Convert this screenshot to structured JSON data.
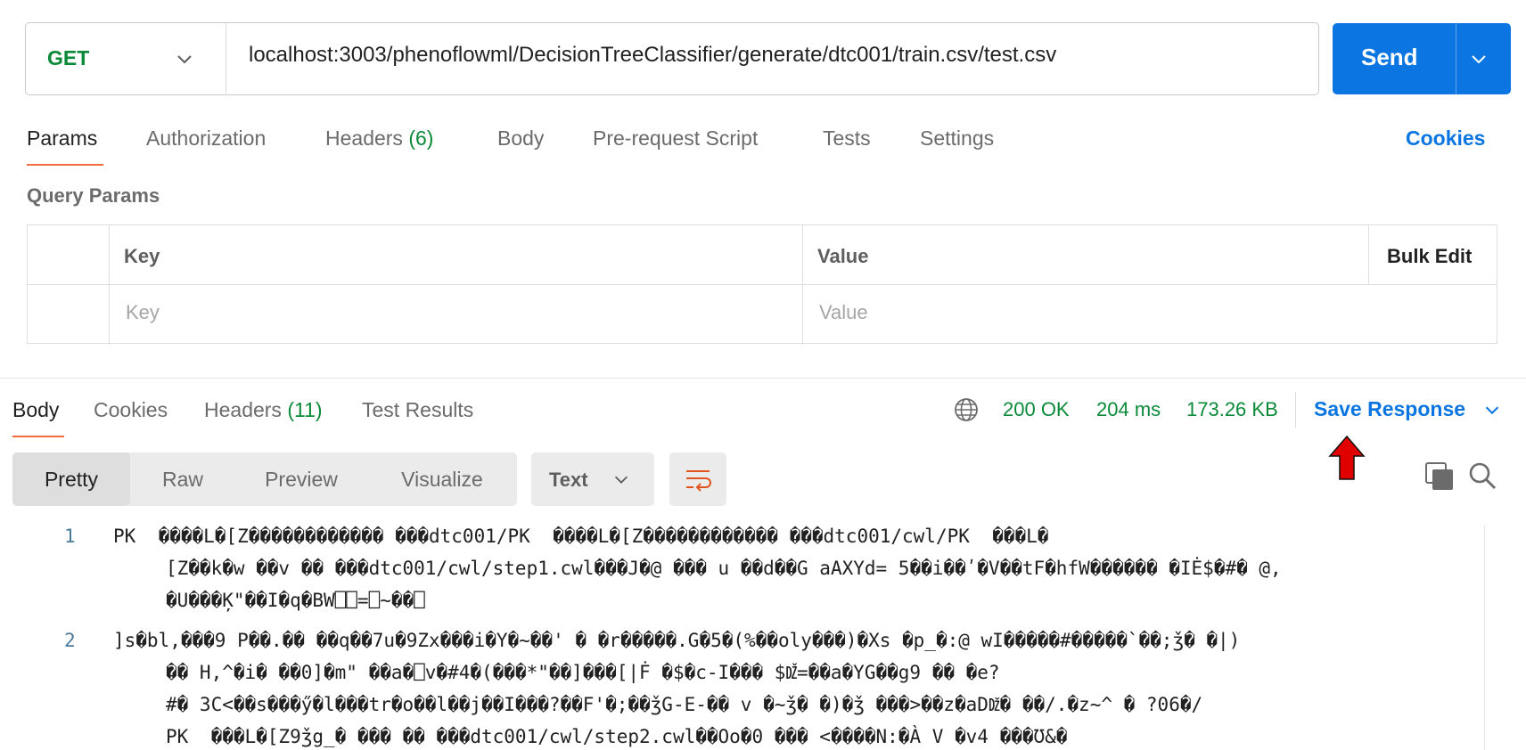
{
  "request": {
    "method": "GET",
    "url": "localhost:3003/phenoflowml/DecisionTreeClassifier/generate/dtc001/train.csv/test.csv",
    "send_label": "Send"
  },
  "request_tabs": [
    {
      "label": "Params",
      "count": ""
    },
    {
      "label": "Authorization",
      "count": ""
    },
    {
      "label": "Headers",
      "count": "(6)"
    },
    {
      "label": "Body",
      "count": ""
    },
    {
      "label": "Pre-request Script",
      "count": ""
    },
    {
      "label": "Tests",
      "count": ""
    },
    {
      "label": "Settings",
      "count": ""
    }
  ],
  "cookies_label": "Cookies",
  "query_params": {
    "title": "Query Params",
    "headers": {
      "key": "Key",
      "value": "Value",
      "bulk_edit": "Bulk Edit"
    },
    "placeholders": {
      "key": "Key",
      "value": "Value"
    }
  },
  "response_tabs": [
    {
      "label": "Body",
      "count": ""
    },
    {
      "label": "Cookies",
      "count": ""
    },
    {
      "label": "Headers",
      "count": "(11)"
    },
    {
      "label": "Test Results",
      "count": ""
    }
  ],
  "response_status": {
    "status": "200 OK",
    "time": "204 ms",
    "size": "173.26 KB",
    "save_label": "Save Response"
  },
  "view_modes": [
    "Pretty",
    "Raw",
    "Preview",
    "Visualize"
  ],
  "format": "Text",
  "colors": {
    "accent": "#0b76e2",
    "success": "#0a8a38",
    "active_tab": "#f26b3a",
    "annotation_arrow": "#e00000"
  },
  "icons": [
    "chevron-down-icon",
    "globe-icon",
    "word-wrap-icon",
    "copy-icon",
    "search-icon",
    "red-arrow-icon"
  ],
  "code_lines": [
    {
      "num": "1",
      "text": "PK  ����L�[Z������������ ���dtc001/PK  ����L�[Z������������ ���dtc001/cwl/PK  ���L�"
    },
    {
      "num": "",
      "text": "[Z��k�w ��v �� ���dtc001/cwl/step1.cwl���J�@ ��� u ��d��G aAXYd= 5��i��ʹ�V��tF�hfW������ �IĖ$�#� @,"
    },
    {
      "num": "",
      "text": "�U���Ķ\"��I�q�BW⎕⎕=⎕~��⎕"
    },
    {
      "num": "2",
      "text": "]s�bl,���9 P��.�� ��q��7u�9Zx���i�Y�~��' � �r�����.G�5�(%��oly���)�Xs �p_�:@ wI�����#�����`��;ǯ� �|)"
    },
    {
      "num": "",
      "text": "�� H,^�i� ��0]�m\" ��a�⎕v�#4�(���*\"��]���[|Ḟ �$�c-I��� $Ǆ=��a�YG��g9 �� �e?"
    },
    {
      "num": "",
      "text": "#� 3C<��s���ӳ�l���tr�o��l��j��I���?��F'�;��ǯG-E-�� v �~ǯ� �)�ǯ ���>��z�aDǅ� ��/.�z~^ � ?06�/"
    },
    {
      "num": "",
      "text": "PK  ���L�[Z9ǯg_� ��� �� ���dtc001/cwl/step2.cwl��Oo�0 ��� <����N:�À V �v4 ���Ʊ&�"
    }
  ]
}
